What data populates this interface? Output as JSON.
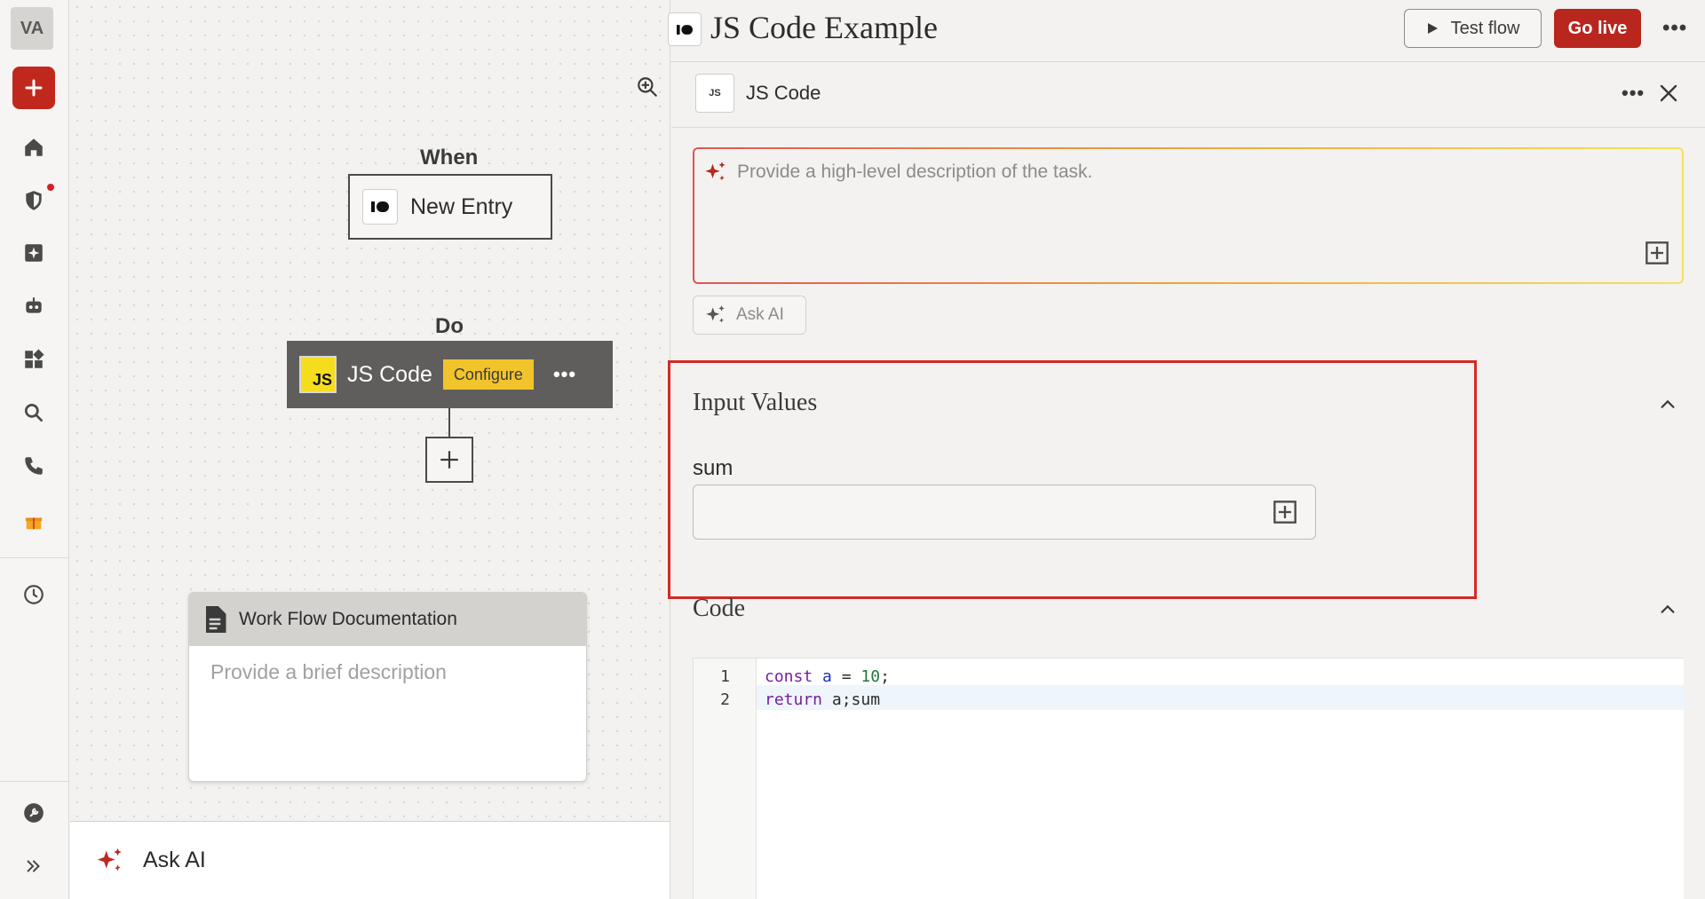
{
  "rail": {
    "avatar_initials": "VA",
    "icons": [
      "plus-icon",
      "home-icon",
      "shield-icon",
      "sparkle-doc-icon",
      "robot-icon",
      "apps-icon",
      "search-icon",
      "phone-icon",
      "gift-icon",
      "clock-icon",
      "wrench-icon",
      "double-chevron-icon"
    ]
  },
  "canvas": {
    "when_label": "When",
    "trigger_label": "New Entry",
    "do_label": "Do",
    "action_label": "JS Code",
    "action_logo_text": "JS",
    "configure_badge": "Configure",
    "more_glyph": "•••",
    "doc_card": {
      "title": "Work Flow Documentation",
      "placeholder": "Provide a brief description"
    },
    "ask_ai_label": "Ask AI"
  },
  "topbar": {
    "flow_title": "JS Code Example",
    "test_flow_label": "Test flow",
    "go_live_label": "Go live",
    "more_glyph": "•••"
  },
  "panel": {
    "logo_text": "JS",
    "title": "JS Code",
    "more_glyph": "•••",
    "ai_prompt_placeholder": "Provide a high-level description of the task.",
    "ask_ai_button": "Ask AI",
    "input_values": {
      "section_title": "Input Values",
      "field_label": "sum",
      "field_value": ""
    },
    "code": {
      "section_title": "Code",
      "line_numbers": [
        "1",
        "2"
      ],
      "line1": {
        "kw": "const",
        "var": "a",
        "eq": " = ",
        "num": "10",
        "end": ";"
      },
      "line2": {
        "kw": "return",
        "rest": " a;sum"
      }
    }
  },
  "colors": {
    "brand_red": "#b8261d",
    "configure_yellow": "#f2c42c",
    "js_yellow": "#f5dd1e",
    "highlight_red": "#d42a25"
  }
}
